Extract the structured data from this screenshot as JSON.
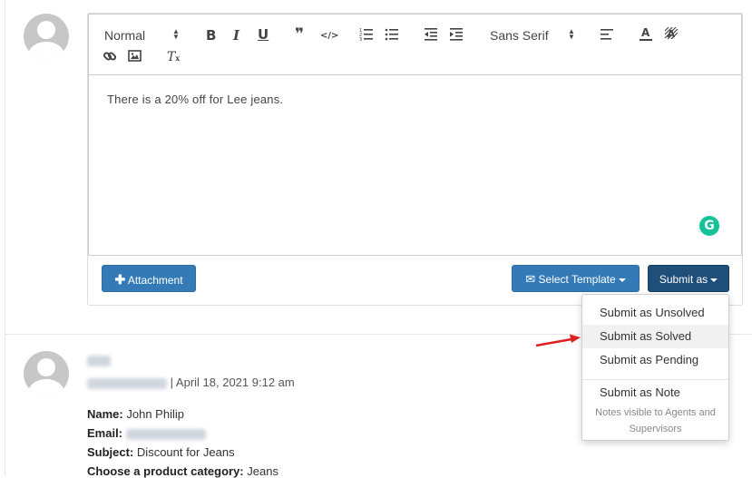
{
  "toolbar": {
    "format_select": "Normal",
    "font_select": "Sans Serif",
    "bold": "B",
    "italic": "I",
    "underline": "U",
    "quote": "❞",
    "code": "</>",
    "clear_format": "T"
  },
  "editor": {
    "text": "There is a 20% off for Lee jeans."
  },
  "grammarly": {
    "label": "G"
  },
  "actions": {
    "attachment": "Attachment",
    "select_template": "Select Template",
    "submit_as": "Submit as"
  },
  "submit_menu": {
    "items": [
      "Submit as Unsolved",
      "Submit as Solved",
      "Submit as Pending"
    ],
    "note_item": "Submit as Note",
    "note_help_line1": "Notes visible to Agents and",
    "note_help_line2": "Supervisors"
  },
  "reply": {
    "separator": "|",
    "date": "April 18, 2021 9:12 am",
    "fields": [
      {
        "label": "Name:",
        "value": "John Philip"
      },
      {
        "label": "Email:",
        "value": ""
      },
      {
        "label": "Subject:",
        "value": "Discount for Jeans"
      },
      {
        "label": "Choose a product category:",
        "value": "Jeans"
      }
    ]
  },
  "colors": {
    "primary_button": "#337ab7",
    "submit_button": "#1f4e79",
    "grammarly": "#15c39a",
    "arrow": "#e02020"
  }
}
